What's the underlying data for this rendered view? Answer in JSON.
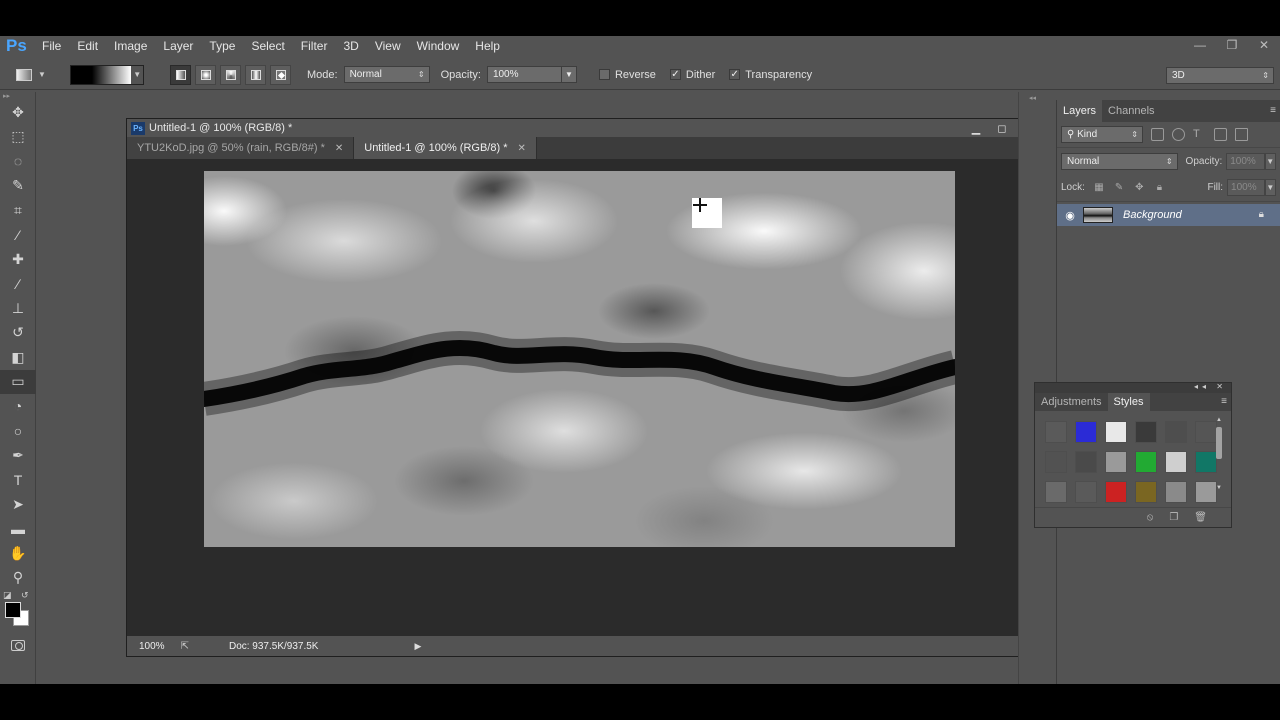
{
  "app": {
    "logo": "Ps",
    "menu": [
      "File",
      "Edit",
      "Image",
      "Layer",
      "Type",
      "Select",
      "Filter",
      "3D",
      "View",
      "Window",
      "Help"
    ],
    "window_controls": [
      "—",
      "❐",
      "✕"
    ]
  },
  "options_bar": {
    "mode_label": "Mode:",
    "mode_value": "Normal",
    "opacity_label": "Opacity:",
    "opacity_value": "100%",
    "reverse_label": "Reverse",
    "dither_label": "Dither",
    "transparency_label": "Transparency",
    "reverse_checked": false,
    "dither_checked": true,
    "transparency_checked": true,
    "workspace": "3D"
  },
  "document": {
    "window_title": "Untitled-1 @ 100% (RGB/8) *",
    "tabs": [
      {
        "label": "YTU2KoD.jpg @ 50% (rain, RGB/8#) *",
        "active": false
      },
      {
        "label": "Untitled-1 @ 100% (RGB/8) *",
        "active": true
      }
    ],
    "zoom": "100%",
    "doc_size": "Doc: 937.5K/937.5K"
  },
  "layers_panel": {
    "tabs": [
      "Layers",
      "Channels"
    ],
    "kind_label": "Kind",
    "blend_mode": "Normal",
    "opacity_label": "Opacity:",
    "opacity_value": "100%",
    "lock_label": "Lock:",
    "fill_label": "Fill:",
    "fill_value": "100%",
    "layers": [
      {
        "name": "Background",
        "visible": true,
        "locked": true
      }
    ]
  },
  "styles_panel": {
    "tabs": [
      "Adjustments",
      "Styles"
    ],
    "swatches": [
      "#5a5a5a",
      "#2b2bd6",
      "#e8e8e8",
      "#3a3a3a",
      "#4e4e4e",
      "#555555",
      "#525252",
      "#4a4a4a",
      "#9a9a9a",
      "#22aa33",
      "#cfcfcf",
      "#117766",
      "#6a6a6a",
      "#5a5a5a",
      "#cc2222",
      "#7a6622",
      "#8a8a8a",
      "#9a9a9a"
    ]
  },
  "colors": {
    "foreground": "#000000",
    "background": "#ffffff",
    "accent": "#4aa6ff",
    "selected_layer": "#5f6f88"
  }
}
